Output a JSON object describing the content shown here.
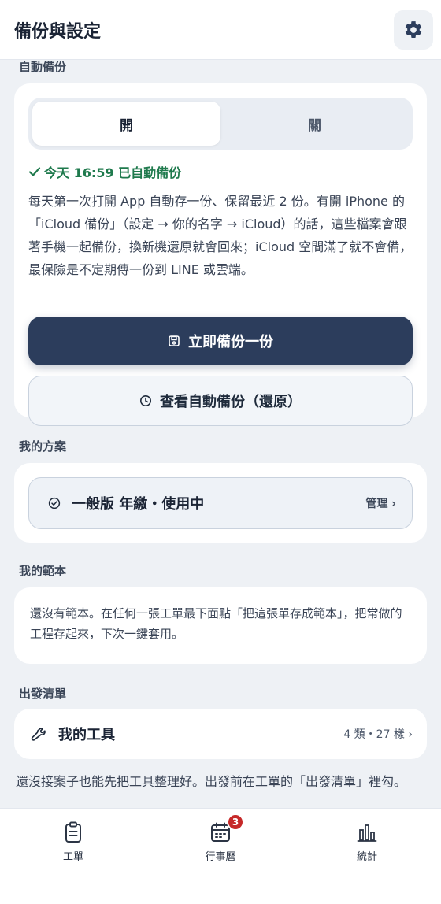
{
  "header": {
    "title": "備份與設定"
  },
  "sections": {
    "auto_backup": "自動備份",
    "my_plan": "我的方案",
    "my_templates": "我的範本",
    "departure_list": "出發清單"
  },
  "backup": {
    "toggle_on": "開",
    "toggle_off": "關",
    "toggle_state": "開",
    "status": "今天 16:59 已自動備份",
    "description": "每天第一次打開 App 自動存一份、保留最近 2 份。有開 iPhone 的「iCloud 備份」（設定 → 你的名字 → iCloud）的話，這些檔案會跟著手機一起備份，換新機還原就會回來；iCloud 空間滿了就不會備，最保險是不定期傳一份到 LINE 或雲端。",
    "backup_now": "立即備份一份",
    "view_backups": "查看自動備份（還原）"
  },
  "plan": {
    "name": "一般版 年繳・使用中",
    "manage": "管理",
    "manage_chevron": "›"
  },
  "templates": {
    "empty_text": "還沒有範本。在任何一張工單最下面點「把這張單存成範本」，把常做的工程存起來，下次一鍵套用。"
  },
  "tools": {
    "label": "我的工具",
    "count": "4 類・27 樣",
    "chevron": "›",
    "note": "還沒接案子也能先把工具整理好。出發前在工單的「出發清單」裡勾。"
  },
  "tabbar": {
    "orders": "工單",
    "calendar": "行事曆",
    "calendar_badge": "3",
    "stats": "統計"
  },
  "colors": {
    "primary": "#2c3d5c",
    "success": "#1f7a4d",
    "badge": "#c62828",
    "background": "#eef1f5"
  }
}
